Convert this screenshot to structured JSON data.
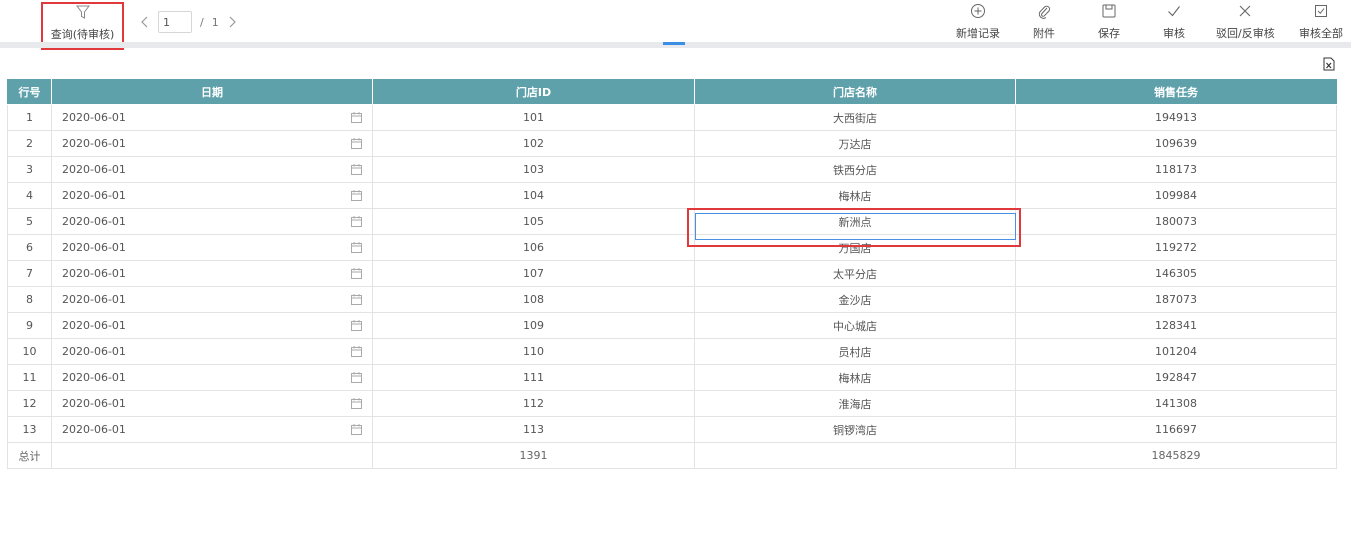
{
  "toolbar": {
    "query_label": "查询(待审核)",
    "pager": {
      "current_page": "1",
      "separator": "/",
      "total_pages": "1"
    },
    "actions": [
      {
        "label": "新增记录",
        "icon": "plus-circle-icon"
      },
      {
        "label": "附件",
        "icon": "paperclip-icon"
      },
      {
        "label": "保存",
        "icon": "save-icon"
      },
      {
        "label": "审核",
        "icon": "check-icon"
      },
      {
        "label": "驳回/反审核",
        "icon": "x-icon"
      },
      {
        "label": "审核全部",
        "icon": "check-square-icon"
      }
    ]
  },
  "table": {
    "headers": [
      "行号",
      "日期",
      "门店ID",
      "门店名称",
      "销售任务"
    ],
    "rows": [
      {
        "no": "1",
        "date": "2020-06-01",
        "store_id": "101",
        "store_name": "大西街店",
        "sales_target": "194913"
      },
      {
        "no": "2",
        "date": "2020-06-01",
        "store_id": "102",
        "store_name": "万达店",
        "sales_target": "109639"
      },
      {
        "no": "3",
        "date": "2020-06-01",
        "store_id": "103",
        "store_name": "铁西分店",
        "sales_target": "118173"
      },
      {
        "no": "4",
        "date": "2020-06-01",
        "store_id": "104",
        "store_name": "梅林店",
        "sales_target": "109984"
      },
      {
        "no": "5",
        "date": "2020-06-01",
        "store_id": "105",
        "store_name": "新洲点",
        "sales_target": "180073"
      },
      {
        "no": "6",
        "date": "2020-06-01",
        "store_id": "106",
        "store_name": "万国店",
        "sales_target": "119272"
      },
      {
        "no": "7",
        "date": "2020-06-01",
        "store_id": "107",
        "store_name": "太平分店",
        "sales_target": "146305"
      },
      {
        "no": "8",
        "date": "2020-06-01",
        "store_id": "108",
        "store_name": "金沙店",
        "sales_target": "187073"
      },
      {
        "no": "9",
        "date": "2020-06-01",
        "store_id": "109",
        "store_name": "中心城店",
        "sales_target": "128341"
      },
      {
        "no": "10",
        "date": "2020-06-01",
        "store_id": "110",
        "store_name": "员村店",
        "sales_target": "101204"
      },
      {
        "no": "11",
        "date": "2020-06-01",
        "store_id": "111",
        "store_name": "梅林店",
        "sales_target": "192847"
      },
      {
        "no": "12",
        "date": "2020-06-01",
        "store_id": "112",
        "store_name": "淮海店",
        "sales_target": "141308"
      },
      {
        "no": "13",
        "date": "2020-06-01",
        "store_id": "113",
        "store_name": "铜锣湾店",
        "sales_target": "116697"
      }
    ],
    "total": {
      "label": "总计",
      "store_id_sum": "1391",
      "sales_target_sum": "1845829"
    }
  },
  "colors": {
    "header_bg": "#5fa1ab",
    "highlight": "#e0383b",
    "focus": "#4a90e2"
  }
}
